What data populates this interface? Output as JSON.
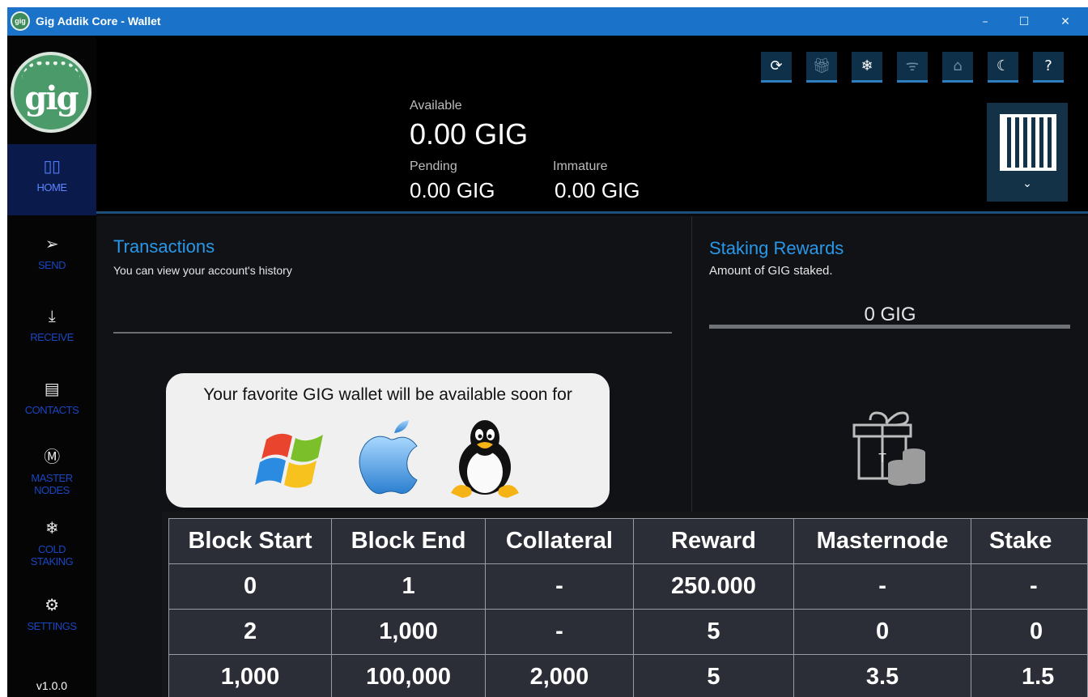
{
  "window": {
    "title": "Gig Addik Core - Wallet",
    "app_icon_text": "gig",
    "controls": {
      "minimize": "–",
      "maximize": "☐",
      "close": "✕"
    }
  },
  "sidebar": {
    "logo_text": "gig",
    "items": [
      {
        "id": "home",
        "label": "HOME",
        "icon": "home-grid-icon",
        "glyph": "▯▯",
        "active": true
      },
      {
        "id": "send",
        "label": "SEND",
        "icon": "send-icon",
        "glyph": "➢"
      },
      {
        "id": "receive",
        "label": "RECEIVE",
        "icon": "download-icon",
        "glyph": "⤓"
      },
      {
        "id": "contacts",
        "label": "CONTACTS",
        "icon": "contacts-book-icon",
        "glyph": "▤"
      },
      {
        "id": "masternodes",
        "label": "MASTER NODES",
        "icon": "masternode-icon",
        "glyph": "Ⓜ"
      },
      {
        "id": "cold_staking",
        "label": "COLD STAKING",
        "icon": "snowflake-icon",
        "glyph": "❄"
      },
      {
        "id": "settings",
        "label": "SETTINGS",
        "icon": "gear-icon",
        "glyph": "⚙"
      }
    ],
    "version": "v1.0.0"
  },
  "header": {
    "available_label": "Available",
    "available_value": "0.00 GIG",
    "pending_label": "Pending",
    "pending_value": "0.00 GIG",
    "immature_label": "Immature",
    "immature_value": "0.00 GIG",
    "toolbar": [
      {
        "name": "sync-icon",
        "glyph": "⟳"
      },
      {
        "name": "gift-icon",
        "glyph": "🎁︎"
      },
      {
        "name": "snowflake-icon",
        "glyph": "❄"
      },
      {
        "name": "wifi-icon",
        "glyph": "ᯤ"
      },
      {
        "name": "unlock-icon",
        "glyph": "⌂"
      },
      {
        "name": "moon-icon",
        "glyph": "☾"
      },
      {
        "name": "help-icon",
        "glyph": "?"
      }
    ],
    "qr_chevron": "⌄"
  },
  "transactions": {
    "title": "Transactions",
    "subtitle": "You can view your account's history"
  },
  "promo": {
    "text": "Your favorite GIG wallet will be available soon for",
    "platforms": [
      "windows-logo-icon",
      "apple-logo-icon",
      "linux-tux-icon"
    ]
  },
  "staking": {
    "title": "Staking Rewards",
    "subtitle": "Amount of GIG staked.",
    "value": "0 GIG"
  },
  "reward_table": {
    "columns": [
      "Block Start",
      "Block End",
      "Collateral",
      "Reward",
      "Masternode",
      "Stake"
    ],
    "rows": [
      [
        "0",
        "1",
        "-",
        "250.000",
        "-",
        "-"
      ],
      [
        "2",
        "1,000",
        "-",
        "5",
        "0",
        "0"
      ],
      [
        "1,000",
        "100,000",
        "2,000",
        "5",
        "3.5",
        "1.5"
      ]
    ]
  }
}
